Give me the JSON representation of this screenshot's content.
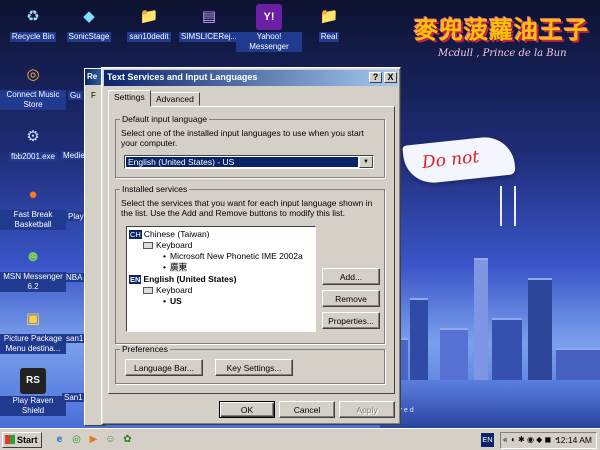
{
  "wallpaper": {
    "logo_text": "麥兜菠蘿油王子",
    "logo_subtitle": "Mcdull , Prince de la Bun",
    "banner_text": "Do not",
    "reserved_text": "rved"
  },
  "desktop_icons": [
    {
      "label": "Recycle Bin",
      "glyph": "♻"
    },
    {
      "label": "SonicStage",
      "glyph": "◆"
    },
    {
      "label": "san10dedit",
      "glyph": "📁"
    },
    {
      "label": "SIMSLICERej...",
      "glyph": "▤"
    },
    {
      "label": "Yahoo! Messenger",
      "glyph": "Y!"
    },
    {
      "label": "Real",
      "glyph": "📁"
    },
    {
      "label": "Connect Music Store",
      "glyph": "◎"
    },
    {
      "label": "fbb2001.exe",
      "glyph": "⚙"
    },
    {
      "label": "Fast Break Basketball",
      "glyph": "●"
    },
    {
      "label": "MSN Messenger 6.2",
      "glyph": "☻"
    },
    {
      "label": "Picture Package Menu destina...",
      "glyph": "▣"
    },
    {
      "label": "Play Raven Shield",
      "glyph": "RS"
    }
  ],
  "partial_icons": [
    "Gu",
    "Medie",
    "Play S",
    "NBA L",
    "san1",
    "San1"
  ],
  "back_window": {
    "title_fragment": "Re",
    "tab_fragment": "F"
  },
  "dialog": {
    "title": "Text Services and Input Languages",
    "help_btn": "?",
    "close_btn": "X",
    "tabs": [
      "Settings",
      "Advanced"
    ],
    "default_group": {
      "legend": "Default input language",
      "description": "Select one of the installed input languages to use when you start your computer.",
      "selected": "English (United States) - US"
    },
    "installed_group": {
      "legend": "Installed services",
      "description": "Select the services that you want for each input language shown in the list. Use the Add and Remove buttons to modify this list.",
      "tree": {
        "lang1_code": "CH",
        "lang1_name": "Chinese (Taiwan)",
        "lang1_category": "Keyboard",
        "lang1_item1": "Microsoft New Phonetic IME 2002a",
        "lang1_item2": "廣東",
        "lang2_code": "EN",
        "lang2_name": "English (United States)",
        "lang2_category": "Keyboard",
        "lang2_item1": "US"
      },
      "add_btn": "Add...",
      "remove_btn": "Remove",
      "properties_btn": "Properties..."
    },
    "preferences_group": {
      "legend": "Preferences",
      "language_bar_btn": "Language Bar...",
      "key_settings_btn": "Key Settings..."
    },
    "ok_btn": "OK",
    "cancel_btn": "Cancel",
    "apply_btn": "Apply"
  },
  "taskbar": {
    "start_label": "Start",
    "quick_launch": [
      "e",
      "◎",
      "▶",
      "☺",
      "✿"
    ],
    "lang_indicator": "EN",
    "tray_chevron": "«",
    "tray_icons": "◐ ✱ ◉ ◆ ◼ ◔",
    "clock": "12:14 AM"
  }
}
